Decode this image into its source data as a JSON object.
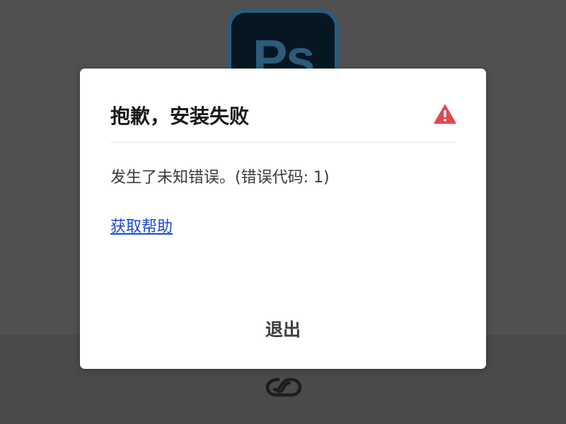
{
  "app_icon": {
    "label": "Ps",
    "icon_name": "photoshop-icon",
    "border_color": "#2b5c7d",
    "fill_color": "#061722",
    "text_color": "#2d5b7a"
  },
  "dialog": {
    "title": "抱歉，安装失败",
    "alert_icon_name": "alert-triangle-icon",
    "alert_color": "#e34850",
    "message": "发生了未知错误。(错误代码: 1)",
    "help_link_text": "获取帮助",
    "link_color": "#1a47d8",
    "quit_button_label": "退出"
  },
  "footer": {
    "logo_icon_name": "creative-cloud-icon"
  },
  "colors": {
    "background": "#505050",
    "dialog_background": "#ffffff"
  }
}
